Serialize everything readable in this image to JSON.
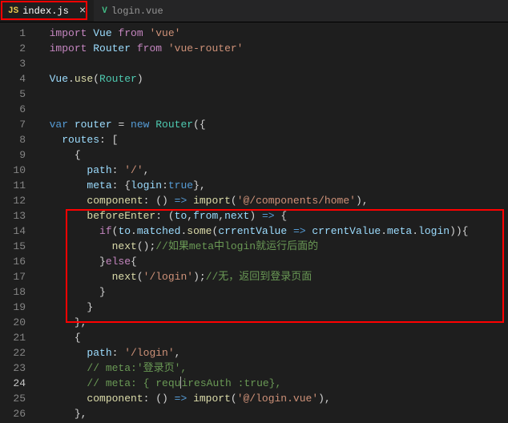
{
  "tabs": [
    {
      "filename": "index.js",
      "active": true,
      "type": "js"
    },
    {
      "filename": "login.vue",
      "active": false,
      "type": "vue"
    }
  ],
  "code_lines": [
    {
      "n": "1",
      "indent": 2,
      "tokens": [
        [
          "kw-import",
          "import"
        ],
        [
          "",
          ""
        ],
        [
          "ident",
          " Vue "
        ],
        [
          "kw-import",
          "from"
        ],
        [
          "",
          ""
        ],
        [
          "str",
          " 'vue'"
        ]
      ]
    },
    {
      "n": "2",
      "indent": 2,
      "tokens": [
        [
          "kw-import",
          "import"
        ],
        [
          "",
          ""
        ],
        [
          "ident",
          " Router "
        ],
        [
          "kw-import",
          "from"
        ],
        [
          "",
          ""
        ],
        [
          "str",
          " 'vue-router'"
        ]
      ]
    },
    {
      "n": "3",
      "indent": 2,
      "tokens": []
    },
    {
      "n": "4",
      "indent": 2,
      "tokens": [
        [
          "ident",
          "Vue"
        ],
        [
          "punct",
          "."
        ],
        [
          "func",
          "use"
        ],
        [
          "punct",
          "("
        ],
        [
          "class",
          "Router"
        ],
        [
          "punct",
          ")"
        ]
      ]
    },
    {
      "n": "5",
      "indent": 2,
      "tokens": []
    },
    {
      "n": "6",
      "indent": 2,
      "tokens": []
    },
    {
      "n": "7",
      "indent": 2,
      "tokens": [
        [
          "kw-var",
          "var"
        ],
        [
          "",
          ""
        ],
        [
          "ident",
          " router "
        ],
        [
          "punct",
          "= "
        ],
        [
          "kw-new",
          "new"
        ],
        [
          "",
          ""
        ],
        [
          "class",
          " Router"
        ],
        [
          "punct",
          "({"
        ]
      ]
    },
    {
      "n": "8",
      "indent": 4,
      "tokens": [
        [
          "ident",
          "routes"
        ],
        [
          "punct",
          ": ["
        ]
      ]
    },
    {
      "n": "9",
      "indent": 6,
      "tokens": [
        [
          "punct",
          "{"
        ]
      ]
    },
    {
      "n": "10",
      "indent": 8,
      "tokens": [
        [
          "ident",
          "path"
        ],
        [
          "punct",
          ": "
        ],
        [
          "str",
          "'/'"
        ],
        [
          "punct",
          ","
        ]
      ]
    },
    {
      "n": "11",
      "indent": 8,
      "tokens": [
        [
          "ident",
          "meta"
        ],
        [
          "punct",
          ": {"
        ],
        [
          "ident",
          "login"
        ],
        [
          "punct",
          ":"
        ],
        [
          "kw-const",
          "true"
        ],
        [
          "punct",
          "},"
        ]
      ]
    },
    {
      "n": "12",
      "indent": 8,
      "tokens": [
        [
          "func",
          "component"
        ],
        [
          "punct",
          ": () "
        ],
        [
          "kw-var",
          "=>"
        ],
        [
          "punct",
          " "
        ],
        [
          "func",
          "import"
        ],
        [
          "punct",
          "("
        ],
        [
          "str",
          "'@/components/home'"
        ],
        [
          "punct",
          "),"
        ]
      ]
    },
    {
      "n": "13",
      "indent": 8,
      "tokens": [
        [
          "func",
          "beforeEnter"
        ],
        [
          "punct",
          ": ("
        ],
        [
          "ident",
          "to"
        ],
        [
          "punct",
          ","
        ],
        [
          "ident",
          "from"
        ],
        [
          "punct",
          ","
        ],
        [
          "ident",
          "next"
        ],
        [
          "punct",
          ") "
        ],
        [
          "kw-var",
          "=>"
        ],
        [
          "punct",
          " {"
        ]
      ]
    },
    {
      "n": "14",
      "indent": 10,
      "tokens": [
        [
          "kw-ctrl",
          "if"
        ],
        [
          "punct",
          "("
        ],
        [
          "ident",
          "to"
        ],
        [
          "punct",
          "."
        ],
        [
          "ident",
          "matched"
        ],
        [
          "punct",
          "."
        ],
        [
          "func",
          "some"
        ],
        [
          "punct",
          "("
        ],
        [
          "ident",
          "crrentValue"
        ],
        [
          "punct",
          " "
        ],
        [
          "kw-var",
          "=>"
        ],
        [
          "punct",
          " "
        ],
        [
          "ident",
          "crrentValue"
        ],
        [
          "punct",
          "."
        ],
        [
          "ident",
          "meta"
        ],
        [
          "punct",
          "."
        ],
        [
          "ident",
          "login"
        ],
        [
          "punct",
          ")){"
        ]
      ]
    },
    {
      "n": "15",
      "indent": 12,
      "tokens": [
        [
          "func",
          "next"
        ],
        [
          "punct",
          "();"
        ],
        [
          "comment",
          "//如果meta中login就运行后面的"
        ]
      ]
    },
    {
      "n": "16",
      "indent": 10,
      "tokens": [
        [
          "punct",
          "}"
        ],
        [
          "kw-ctrl",
          "else"
        ],
        [
          "punct",
          "{"
        ]
      ]
    },
    {
      "n": "17",
      "indent": 12,
      "tokens": [
        [
          "func",
          "next"
        ],
        [
          "punct",
          "("
        ],
        [
          "str",
          "'/login'"
        ],
        [
          "punct",
          ");"
        ],
        [
          "comment",
          "//无，返回到登录页面"
        ]
      ]
    },
    {
      "n": "18",
      "indent": 10,
      "tokens": [
        [
          "punct",
          "}"
        ]
      ]
    },
    {
      "n": "19",
      "indent": 8,
      "tokens": [
        [
          "punct",
          "}"
        ]
      ]
    },
    {
      "n": "20",
      "indent": 6,
      "tokens": [
        [
          "punct",
          "},"
        ]
      ]
    },
    {
      "n": "21",
      "indent": 6,
      "tokens": [
        [
          "punct",
          "{"
        ]
      ]
    },
    {
      "n": "22",
      "indent": 8,
      "tokens": [
        [
          "ident",
          "path"
        ],
        [
          "punct",
          ": "
        ],
        [
          "str",
          "'/login'"
        ],
        [
          "punct",
          ","
        ]
      ]
    },
    {
      "n": "23",
      "indent": 8,
      "tokens": [
        [
          "comment",
          "// meta:'登录页',"
        ]
      ]
    },
    {
      "n": "24",
      "indent": 8,
      "active": true,
      "tokens": [
        [
          "comment",
          "// meta: { requ"
        ],
        [
          "cursor",
          ""
        ],
        [
          "comment",
          "iresAuth :true},"
        ]
      ]
    },
    {
      "n": "25",
      "indent": 8,
      "tokens": [
        [
          "func",
          "component"
        ],
        [
          "punct",
          ": () "
        ],
        [
          "kw-var",
          "=>"
        ],
        [
          "punct",
          " "
        ],
        [
          "func",
          "import"
        ],
        [
          "punct",
          "("
        ],
        [
          "str",
          "'@/login.vue'"
        ],
        [
          "punct",
          "),"
        ]
      ]
    },
    {
      "n": "26",
      "indent": 6,
      "tokens": [
        [
          "punct",
          "},"
        ]
      ]
    }
  ],
  "icons": {
    "close": "×",
    "js": "JS",
    "vue": "V"
  }
}
